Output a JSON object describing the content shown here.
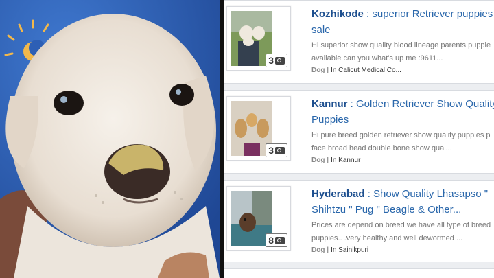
{
  "listings": [
    {
      "city": "Kozhikode",
      "title_rest": " : superior Retriever puppies",
      "title_line2": "sale",
      "desc_line1": "Hi superior show quality blood lineage parents puppie",
      "desc_line2": "available can you what's up me :9611...",
      "category": "Dog",
      "location": "In Calicut Medical Co...",
      "photo_count": "3"
    },
    {
      "city": "Kannur",
      "title_rest": " : Golden Retriever Show Quality",
      "title_line2": "Puppies",
      "desc_line1": "Hi pure breed golden retriever show quality puppies p",
      "desc_line2": "face broad head double bone show qual...",
      "category": "Dog",
      "location": "In Kannur",
      "photo_count": "3"
    },
    {
      "city": "Hyderabad",
      "title_rest": " : Show Quality Lhasapso \"",
      "title_line2": "Shihtzu \" Pug \" Beagle & Other...",
      "desc_line1": "Prices are depend on breed we have all type of breed",
      "desc_line2": "puppies.. .very healthy and well dewormed ...",
      "category": "Dog",
      "location": "In Sainikpuri",
      "photo_count": "8"
    }
  ],
  "icons": {
    "camera": "camera-icon"
  },
  "colors": {
    "title_link": "#2a67ab",
    "city_bold": "#1d4f8f",
    "background_photo_blue": "#2d5fb5"
  }
}
